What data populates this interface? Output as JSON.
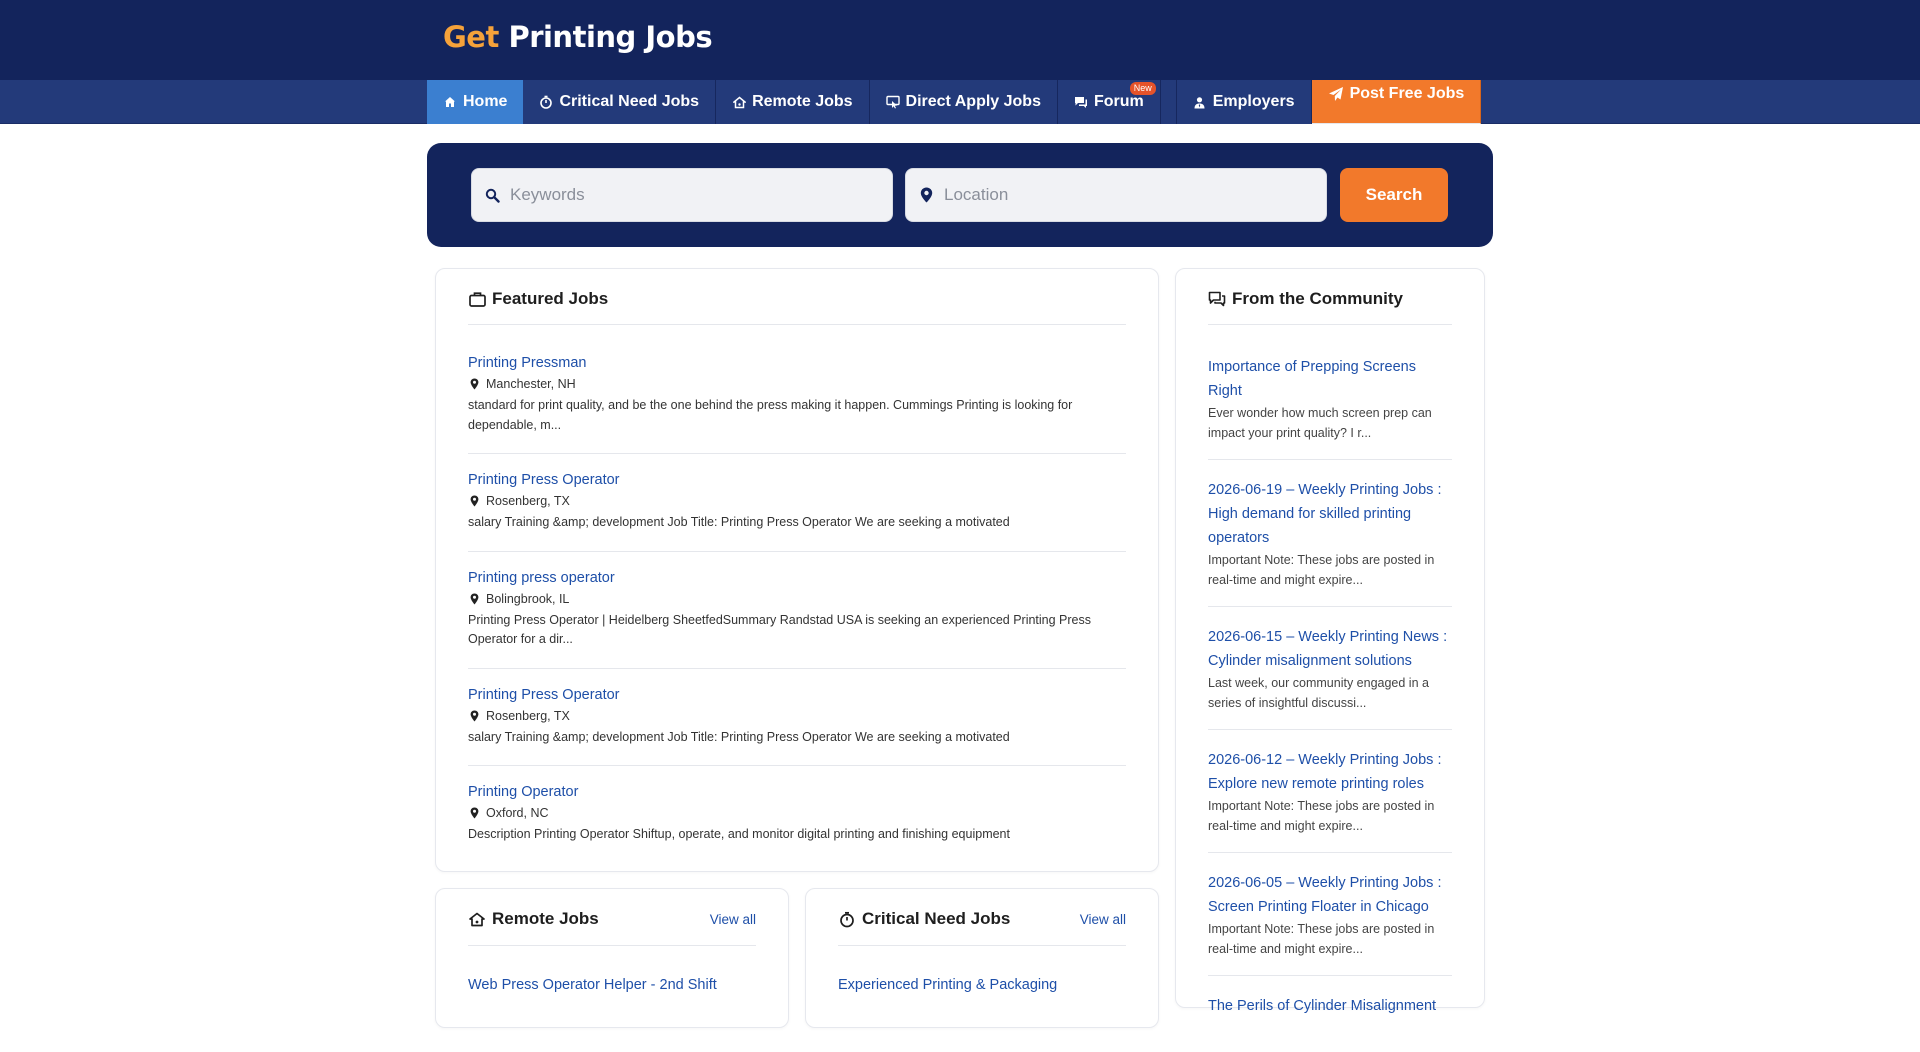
{
  "brand": {
    "part1": "Get",
    "part2": " Printing Jobs",
    "accent": "#f6a23a",
    "navy": "#13245c"
  },
  "nav": {
    "home": "Home",
    "critical": "Critical Need Jobs",
    "remote": "Remote Jobs",
    "direct": "Direct Apply Jobs",
    "forum": "Forum",
    "forum_badge": "New",
    "employers": "Employers",
    "post": "Post Free Jobs"
  },
  "search": {
    "keywords_placeholder": "Keywords",
    "location_placeholder": "Location",
    "button": "Search"
  },
  "featured": {
    "title": "Featured Jobs",
    "jobs": [
      {
        "title": "Printing Pressman",
        "location": "Manchester, NH",
        "desc": "standard for print quality, and be the one behind the press making it happen. Cummings Printing is looking for dependable, m..."
      },
      {
        "title": "Printing Press Operator",
        "location": "Rosenberg, TX",
        "desc": "salary Training &amp; development Job Title: Printing Press Operator We are seeking a motivated"
      },
      {
        "title": "Printing press operator",
        "location": "Bolingbrook, IL",
        "desc": "Printing Press Operator | Heidelberg SheetfedSummary Randstad USA is seeking an experienced Printing Press Operator for a dir..."
      },
      {
        "title": "Printing Press Operator",
        "location": "Rosenberg, TX",
        "desc": "salary Training &amp; development Job Title: Printing Press Operator We are seeking a motivated"
      },
      {
        "title": "Printing Operator",
        "location": "Oxford, NC",
        "desc": "Description Printing Operator Shiftup, operate, and monitor digital printing and finishing equipment"
      }
    ]
  },
  "community": {
    "title": "From the Community",
    "posts": [
      {
        "title": "Importance of Prepping Screens Right",
        "excerpt": "Ever wonder how much screen prep can impact your print quality? I r..."
      },
      {
        "title": "2026-06-19 – Weekly Printing Jobs : High demand for skilled printing operators",
        "excerpt": "Important Note: These jobs are posted in real-time and might expire..."
      },
      {
        "title": "2026-06-15 – Weekly Printing News : Cylinder misalignment solutions",
        "excerpt": "Last week, our community engaged in a series of insightful discussi..."
      },
      {
        "title": "2026-06-12 – Weekly Printing Jobs : Explore new remote printing roles",
        "excerpt": "Important Note: These jobs are posted in real-time and might expire..."
      },
      {
        "title": "2026-06-05 – Weekly Printing Jobs : Screen Printing Floater in Chicago",
        "excerpt": "Important Note: These jobs are posted in real-time and might expire..."
      },
      {
        "title": "The Perils of Cylinder Misalignment",
        "excerpt": ""
      }
    ]
  },
  "remote_section": {
    "title": "Remote Jobs",
    "view_all": "View all",
    "first_job": "Web Press Operator Helper - 2nd Shift"
  },
  "critical_section": {
    "title": "Critical Need Jobs",
    "view_all": "View all",
    "first_job": "Experienced Printing & Packaging"
  }
}
